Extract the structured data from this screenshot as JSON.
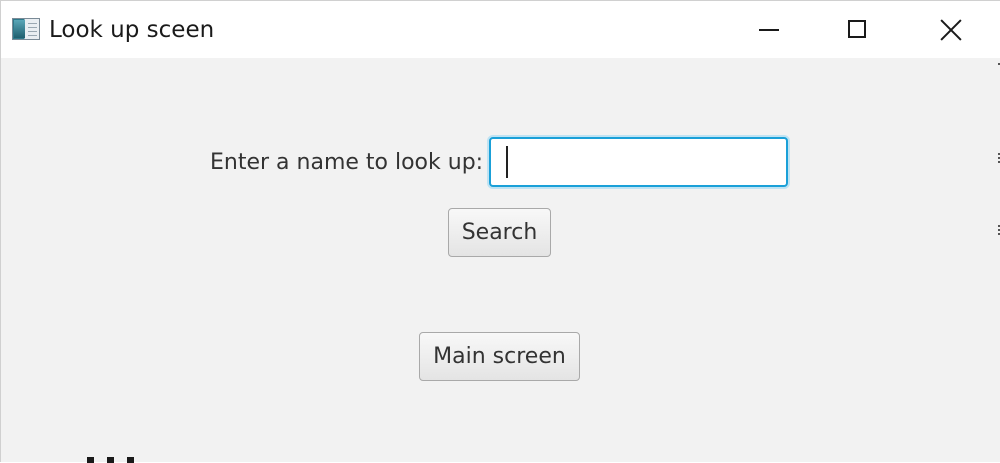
{
  "window": {
    "title": "Look up sceen",
    "icon": "application-window-icon",
    "controls": {
      "minimize": "minimize-icon",
      "maximize": "maximize-icon",
      "close": "close-icon"
    }
  },
  "form": {
    "label": "Enter a name to look up:",
    "input_value": "",
    "search_label": "Search",
    "main_label": "Main screen"
  },
  "colors": {
    "focus_border": "#1aa0d8",
    "background": "#f2f2f2",
    "titlebar": "#ffffff"
  }
}
